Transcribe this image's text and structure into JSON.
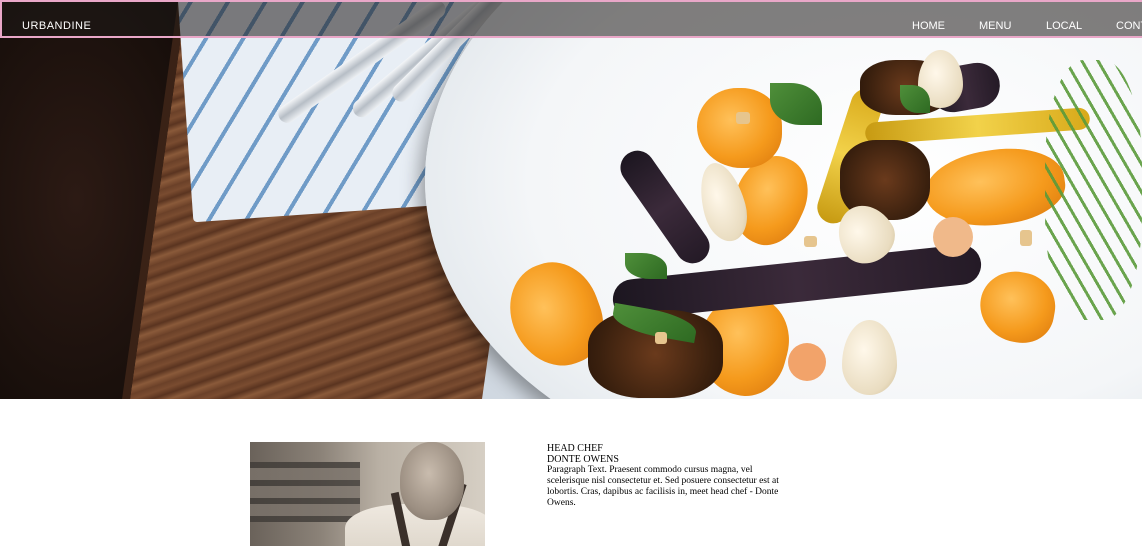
{
  "header": {
    "brand": "URBANDINE",
    "nav": [
      {
        "label": "HOME"
      },
      {
        "label": "MENU"
      },
      {
        "label": "LOCAL"
      },
      {
        "label": "CONT"
      }
    ]
  },
  "chef": {
    "title": "HEAD CHEF",
    "name": "DONTE OWENS",
    "bio": "Paragraph Text. Praesent commodo cursus magna, vel scelerisque nisl consectetur et. Sed posuere consectetur est at lobortis. Cras, dapibus ac facilisis in, meet head chef - Donte Owens."
  },
  "colors": {
    "nav_border": "#e9a7c8",
    "nav_text": "#ffffff",
    "body_text": "#000000"
  }
}
